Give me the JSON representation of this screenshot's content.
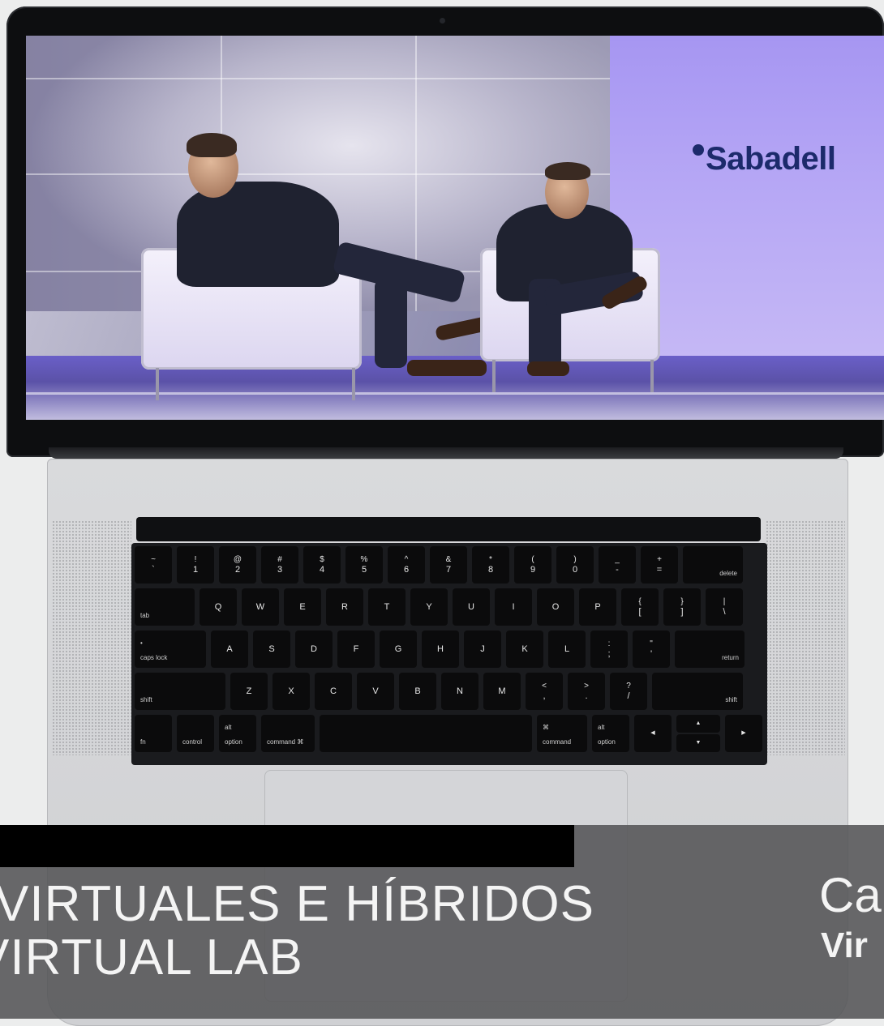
{
  "screen": {
    "sponsor_logo": "Sabadell"
  },
  "keyboard": {
    "row1": [
      {
        "top": "~",
        "bottom": "`"
      },
      {
        "top": "!",
        "bottom": "1"
      },
      {
        "top": "@",
        "bottom": "2"
      },
      {
        "top": "#",
        "bottom": "3"
      },
      {
        "top": "$",
        "bottom": "4"
      },
      {
        "top": "%",
        "bottom": "5"
      },
      {
        "top": "^",
        "bottom": "6"
      },
      {
        "top": "&",
        "bottom": "7"
      },
      {
        "top": "*",
        "bottom": "8"
      },
      {
        "top": "(",
        "bottom": "9"
      },
      {
        "top": ")",
        "bottom": "0"
      },
      {
        "top": "_",
        "bottom": "-"
      },
      {
        "top": "+",
        "bottom": "="
      }
    ],
    "delete": "delete",
    "tab": "tab",
    "row2": [
      "Q",
      "W",
      "E",
      "R",
      "T",
      "Y",
      "U",
      "I",
      "O",
      "P"
    ],
    "row2_extra": [
      {
        "top": "{",
        "bottom": "["
      },
      {
        "top": "}",
        "bottom": "]"
      },
      {
        "top": "|",
        "bottom": "\\"
      }
    ],
    "caps_dot": "•",
    "caps_lock": "caps lock",
    "row3": [
      "A",
      "S",
      "D",
      "F",
      "G",
      "H",
      "J",
      "K",
      "L"
    ],
    "row3_extra": [
      {
        "top": ":",
        "bottom": ";"
      },
      {
        "top": "\"",
        "bottom": "'"
      }
    ],
    "return": "return",
    "shift_left": "shift",
    "row4": [
      "Z",
      "X",
      "C",
      "V",
      "B",
      "N",
      "M"
    ],
    "row4_extra": [
      {
        "top": "<",
        "bottom": ","
      },
      {
        "top": ">",
        "bottom": "."
      },
      {
        "top": "?",
        "bottom": "/"
      }
    ],
    "shift_right": "shift",
    "fn": "fn",
    "control": "control",
    "alt_left": "alt",
    "option_left": "option",
    "command_left": "command ⌘",
    "command_right_symbol": "⌘",
    "command_right": "command",
    "alt_right": "alt",
    "option_right": "option",
    "arrow_left": "◀",
    "arrow_up": "▲",
    "arrow_down": "▼",
    "arrow_right": "▶"
  },
  "banner": {
    "line1": "VIRTUALES E HÍBRIDOS",
    "line2": "VIRTUAL LAB",
    "brand_top": "Ca",
    "brand_bottom": "Vir"
  },
  "colors": {
    "banner_overlay": "#545456",
    "banner_text": "#f4f4f4",
    "sponsor_logo": "#1c2a6b"
  }
}
